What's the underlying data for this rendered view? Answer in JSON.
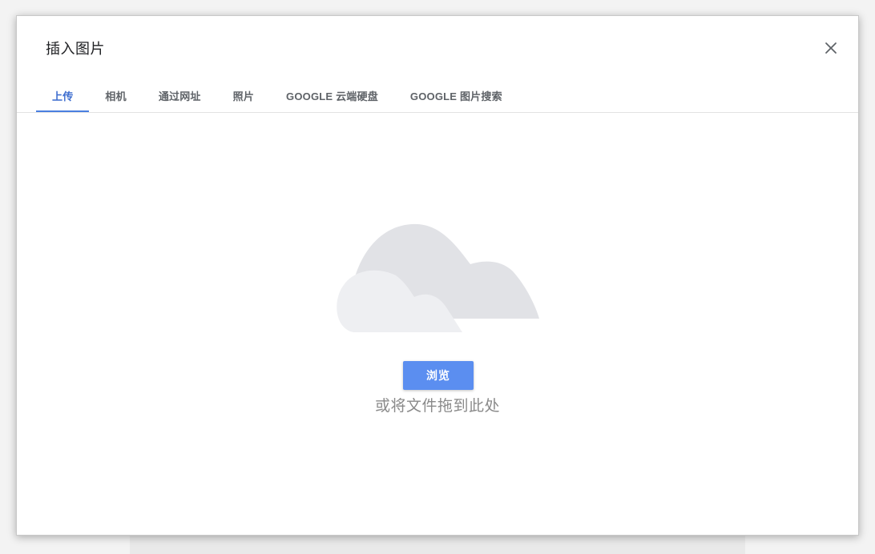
{
  "dialog": {
    "title": "插入图片",
    "close_icon": "close-icon"
  },
  "tabs": [
    {
      "label": "上传",
      "active": true
    },
    {
      "label": "相机",
      "active": false
    },
    {
      "label": "通过网址",
      "active": false
    },
    {
      "label": "照片",
      "active": false
    },
    {
      "label": "GOOGLE 云端硬盘",
      "active": false
    },
    {
      "label": "GOOGLE 图片搜索",
      "active": false
    }
  ],
  "upload": {
    "illustration_icon": "cloud-icon",
    "browse_label": "浏览",
    "drop_hint": "或将文件拖到此处"
  },
  "colors": {
    "accent": "#4a7fe0",
    "button": "#5b8ef0",
    "cloud_back": "#e1e2e6",
    "cloud_front": "#eeeff2"
  }
}
